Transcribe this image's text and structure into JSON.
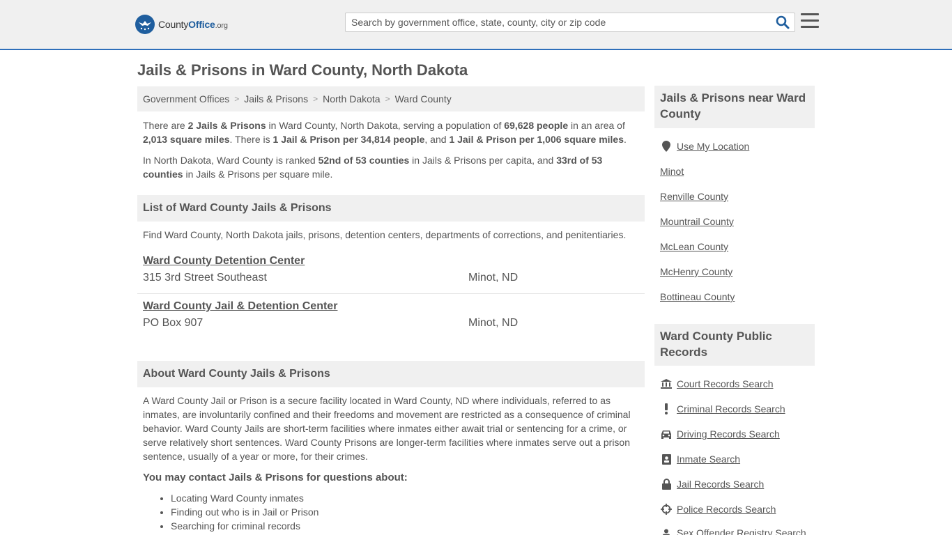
{
  "header": {
    "logo_county": "County",
    "logo_office": "Office",
    "logo_org": ".org",
    "search_placeholder": "Search by government office, state, county, city or zip code"
  },
  "page_title": "Jails & Prisons in Ward County, North Dakota",
  "breadcrumb": [
    "Government Offices",
    "Jails & Prisons",
    "North Dakota",
    "Ward County"
  ],
  "intro": {
    "p1": {
      "t1": "There are ",
      "b1": "2 Jails & Prisons",
      "t2": " in Ward County, North Dakota, serving a population of ",
      "b2": "69,628 people",
      "t3": " in an area of ",
      "b3": "2,013 square miles",
      "t4": ". There is ",
      "b4": "1 Jail & Prison per 34,814 people",
      "t5": ", and ",
      "b5": "1 Jail & Prison per 1,006 square miles",
      "t6": "."
    },
    "p2": {
      "t1": "In North Dakota, Ward County is ranked ",
      "b1": "52nd of 53 counties",
      "t2": " in Jails & Prisons per capita, and ",
      "b2": "33rd of 53 counties",
      "t3": " in Jails & Prisons per square mile."
    }
  },
  "list_section": {
    "title": "List of Ward County Jails & Prisons",
    "description": "Find Ward County, North Dakota jails, prisons, detention centers, departments of corrections, and penitentiaries.",
    "listings": [
      {
        "name": "Ward County Detention Center",
        "address": "315 3rd Street Southeast",
        "city": "Minot, ND"
      },
      {
        "name": "Ward County Jail & Detention Center",
        "address": "PO Box 907",
        "city": "Minot, ND"
      }
    ]
  },
  "about_section": {
    "title": "About Ward County Jails & Prisons",
    "text": "A Ward County Jail or Prison is a secure facility located in Ward County, ND where individuals, referred to as inmates, are involuntarily confined and their freedoms and movement are restricted as a consequence of criminal behavior. Ward County Jails are short-term facilities where inmates either await trial or sentencing for a crime, or serve relatively short sentences. Ward County Prisons are longer-term facilities where inmates serve out a prison sentence, usually of a year or more, for their crimes.",
    "contact_heading": "You may contact Jails & Prisons for questions about:",
    "bullets": [
      "Locating Ward County inmates",
      "Finding out who is in Jail or Prison",
      "Searching for criminal records"
    ]
  },
  "sidebar": {
    "nearby_title": "Jails & Prisons near Ward County",
    "use_location": "Use My Location",
    "nearby": [
      "Minot",
      "Renville County",
      "Mountrail County",
      "McLean County",
      "McHenry County",
      "Bottineau County"
    ],
    "records_title": "Ward County Public Records",
    "records": [
      {
        "label": "Court Records Search",
        "icon": "courthouse-icon"
      },
      {
        "label": "Criminal Records Search",
        "icon": "exclamation-icon"
      },
      {
        "label": "Driving Records Search",
        "icon": "car-icon"
      },
      {
        "label": "Inmate Search",
        "icon": "inmate-badge-icon"
      },
      {
        "label": "Jail Records Search",
        "icon": "lock-icon"
      },
      {
        "label": "Police Records Search",
        "icon": "crosshair-icon"
      },
      {
        "label": "Sex Offender Registry Search",
        "icon": "person-icon"
      }
    ]
  },
  "colors": {
    "brand_blue": "#1f5e9e",
    "header_border": "#2e6fba",
    "panel_bg": "#f0f0f0",
    "text": "#555555"
  }
}
